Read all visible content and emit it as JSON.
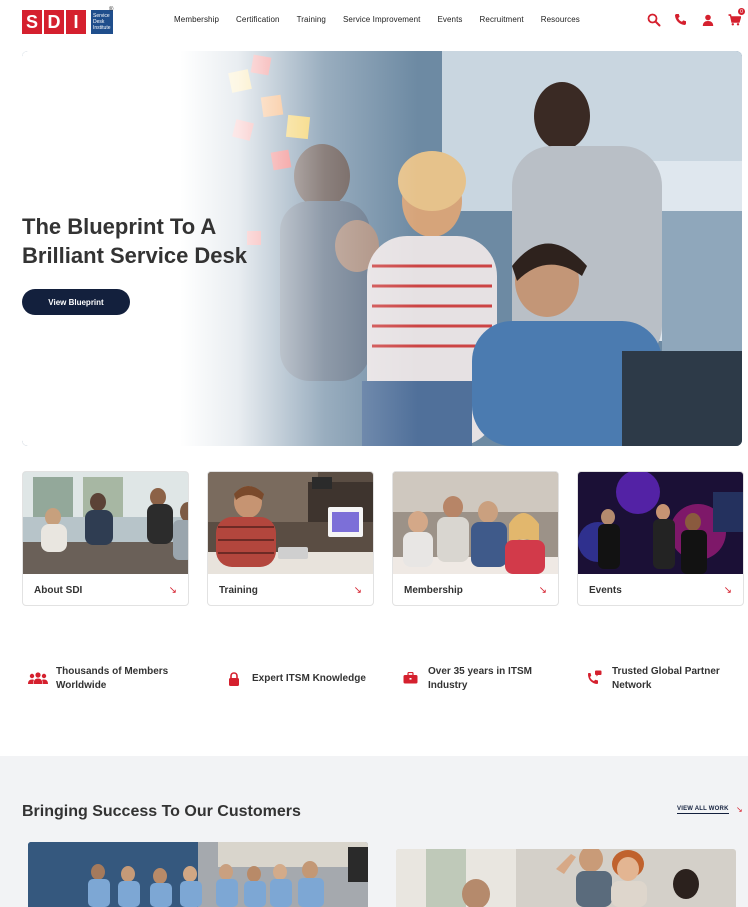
{
  "brand": {
    "letters": [
      "S",
      "D",
      "I"
    ],
    "subtext": [
      "Service",
      "Desk",
      "Institute"
    ],
    "registered": "®",
    "red": "#d5202e",
    "navy": "#13203d",
    "blue": "#1f4e8c"
  },
  "nav": {
    "items": [
      "Membership",
      "Certification",
      "Training",
      "Service Improvement",
      "Events",
      "Recruitment",
      "Resources"
    ]
  },
  "header_icons": {
    "search": "search-icon",
    "phone": "phone-icon",
    "account": "user-icon",
    "cart": "cart-icon",
    "cart_count": "0"
  },
  "hero": {
    "title_line1": "The Blueprint To A",
    "title_line2": "Brilliant Service Desk",
    "button_label": "View Blueprint"
  },
  "cards": [
    {
      "label": "About SDI",
      "arrow": "↘"
    },
    {
      "label": "Training",
      "arrow": "↘"
    },
    {
      "label": "Membership",
      "arrow": "↘"
    },
    {
      "label": "Events",
      "arrow": "↘"
    }
  ],
  "features": [
    {
      "icon": "members-icon",
      "line1": "Thousands of Members",
      "line2": "Worldwide"
    },
    {
      "icon": "lock-icon",
      "line1": "Expert ITSM Knowledge",
      "line2": ""
    },
    {
      "icon": "briefcase-icon",
      "line1": "Over 35 years in ITSM",
      "line2": "Industry"
    },
    {
      "icon": "phone-chat-icon",
      "line1": "Trusted Global Partner",
      "line2": "Network"
    }
  ],
  "success": {
    "title": "Bringing Success To Our Customers",
    "view_all": "VIEW ALL WORK",
    "view_all_arrow": "↘"
  }
}
